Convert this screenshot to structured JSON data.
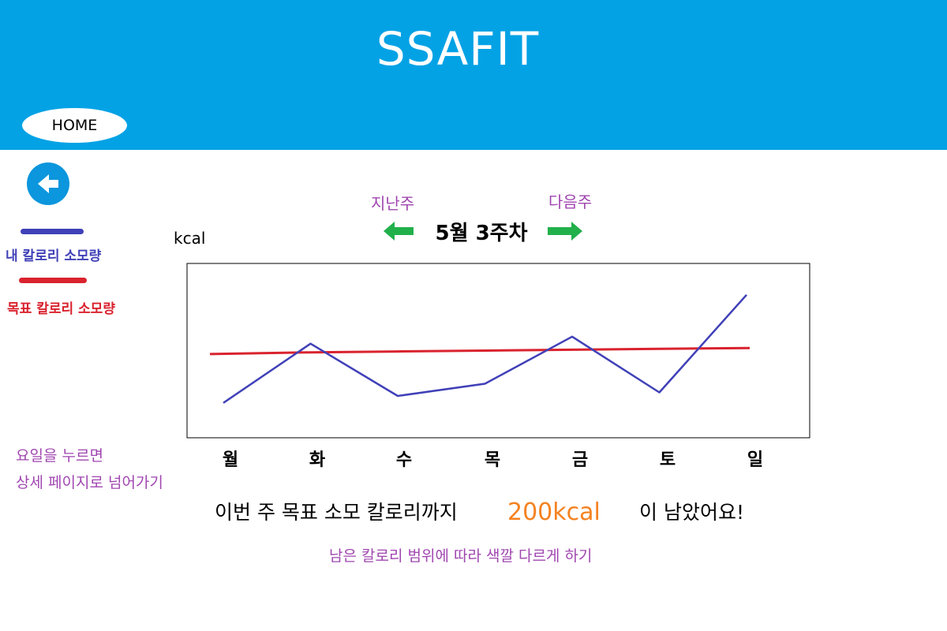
{
  "app": {
    "title": "SSAFIT",
    "home_label": "HOME"
  },
  "colors": {
    "header_bg": "#03a2e5",
    "my_calories": "#4040b8",
    "target_calories": "#d9232e",
    "note_purple": "#a046b0",
    "remaining_orange": "#f58220",
    "arrow_green": "#22b04b"
  },
  "icons": {
    "back": "back-arrow-icon",
    "prev": "left-arrow-icon",
    "next": "right-arrow-icon"
  },
  "legend": {
    "my_label": "내 칼로리 소모량",
    "target_label": "목표 칼로리 소모량"
  },
  "week_nav": {
    "prev_label": "지난주",
    "next_label": "다음주",
    "current": "5월 3주차"
  },
  "chart_data": {
    "type": "line",
    "ylabel": "kcal",
    "categories": [
      "월",
      "화",
      "수",
      "목",
      "금",
      "토",
      "일"
    ],
    "ylim": [
      0,
      100
    ],
    "series": [
      {
        "name": "내 칼로리 소모량",
        "values": [
          20,
          54,
          24,
          31,
          58,
          26,
          82
        ]
      },
      {
        "name": "목표 칼로리 소모량",
        "values": [
          48,
          49,
          49.5,
          50,
          50.5,
          51,
          51.5
        ]
      }
    ]
  },
  "notes": {
    "day_click_line1": "요일을 누르면",
    "day_click_line2": "상세 페이지로 넘어가기",
    "color_note": "남은 칼로리 범위에 따라 색깔 다르게 하기"
  },
  "summary": {
    "prefix": "이번 주 목표 소모 칼로리까지",
    "remaining": "200kcal",
    "suffix": "이 남았어요!"
  }
}
